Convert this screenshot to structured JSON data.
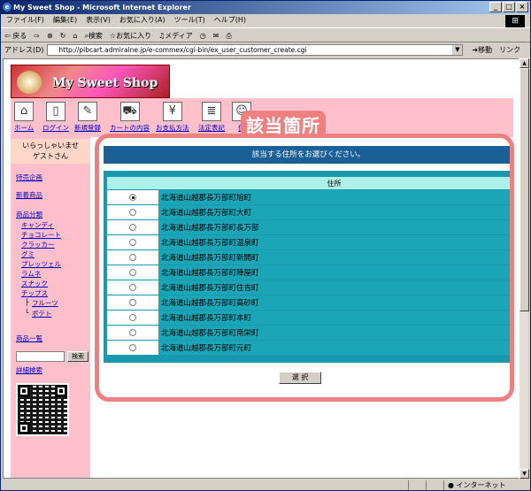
{
  "window": {
    "title": "My Sweet Shop - Microsoft Internet Explorer"
  },
  "menubar": [
    "ファイル(F)",
    "編集(E)",
    "表示(V)",
    "お気に入り(A)",
    "ツール(T)",
    "ヘルプ(H)"
  ],
  "toolbar": {
    "back": "戻る",
    "search": "検索",
    "favorites": "お気に入り",
    "media": "メディア"
  },
  "addressbar": {
    "label": "アドレス(D)",
    "url": "http://pibcart.admiralne.jp/e-commex/cgi-bin/ex_user_customer_create.cgi",
    "go": "移動",
    "links": "リンク"
  },
  "statusbar": {
    "zone": "インターネット"
  },
  "site": {
    "logo": "My Sweet Shop"
  },
  "nav": [
    {
      "label": "ホーム",
      "icon": "home-icon"
    },
    {
      "label": "ログイン",
      "icon": "login-door-icon"
    },
    {
      "label": "新規登録",
      "icon": "pen-icon"
    },
    {
      "label": "カートの内容",
      "icon": "cart-icon"
    },
    {
      "label": "お支払方法",
      "icon": "yen-icon"
    },
    {
      "label": "法定表記",
      "icon": "document-icon"
    },
    {
      "label": "個",
      "icon": "person-icon"
    }
  ],
  "sidebar": {
    "welcome1": "いらっしゃいませ",
    "welcome2": "ゲストさん",
    "special": "特売企画",
    "new": "新着商品",
    "category": "商品分類",
    "categories": [
      "キャンディ",
      "チョコレート",
      "クラッカー",
      "グミ",
      "プレッツェル",
      "ラムネ",
      "スナック",
      "チップス"
    ],
    "sub": [
      "フルーツ",
      "ポテト"
    ],
    "list": "商品一覧",
    "search_btn": "検索",
    "advanced": "詳細検索"
  },
  "main": {
    "header": "該当する住所をお選びください。",
    "col_address": "住所",
    "rows": [
      "北海道山越郡長万部町旭町",
      "北海道山越郡長万部町大町",
      "北海道山越郡長万部町長万部",
      "北海道山越郡長万部町温泉町",
      "北海道山越郡長万部町新開町",
      "北海道山越郡長万部町陣屋町",
      "北海道山越郡長万部町住吉町",
      "北海道山越郡長万部町高砂町",
      "北海道山越郡長万部町本町",
      "北海道山越郡長万部町南栄町",
      "北海道山越郡長万部町元町"
    ],
    "selected_index": 0,
    "submit": "選 択"
  },
  "annotation": "該当箇所",
  "colors": {
    "header": "#1a5f96",
    "table": "#1899b0",
    "highlight": "#f08080",
    "sidebar": "#ffc0cb"
  }
}
